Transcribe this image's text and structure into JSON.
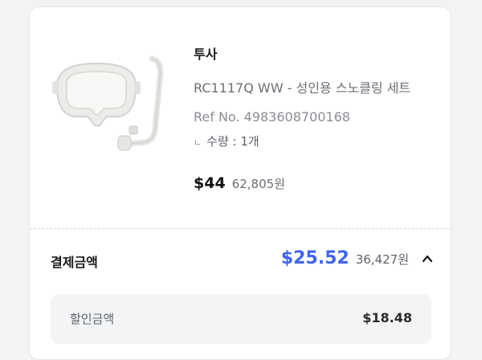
{
  "product": {
    "brand": "투사",
    "name": "RC1117Q WW - 성인용 스노클링 세트",
    "ref": "Ref No. 4983608700168",
    "quantity_mark": "ㄴ",
    "quantity": "수량 : 1개",
    "price_usd": "$44",
    "price_krw": "62,805원",
    "image_icon": "snorkel-mask-set"
  },
  "payment": {
    "label": "결제금액",
    "amount_usd": "$25.52",
    "amount_krw": "36,427원",
    "toggle_icon": "chevron-up",
    "discount_label": "할인금액",
    "discount_value": "$18.48",
    "accent_color": "#3d63f0"
  }
}
